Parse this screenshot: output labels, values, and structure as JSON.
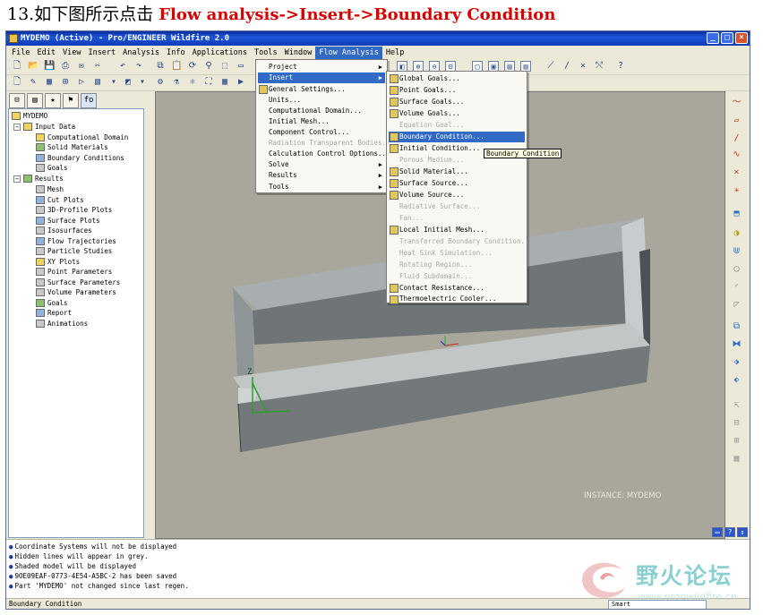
{
  "caption": {
    "prefix": "13.如下图所示点击 ",
    "highlight": "Flow analysis->Insert->Boundary Condition"
  },
  "window": {
    "title": "MYDEMO (Active) - Pro/ENGINEER Wildfire 2.0",
    "min": "_",
    "max": "□",
    "close": "×"
  },
  "menubar": [
    "File",
    "Edit",
    "View",
    "Insert",
    "Analysis",
    "Info",
    "Applications",
    "Tools",
    "Window",
    "Flow Analysis",
    "Help"
  ],
  "tree": {
    "root": "MYDEMO",
    "input_data": "Input Data",
    "input_children": [
      "Computational Domain",
      "Solid Materials",
      "Boundary Conditions",
      "Goals"
    ],
    "results": "Results",
    "results_children": [
      "Mesh",
      "Cut Plots",
      "3D-Profile Plots",
      "Surface Plots",
      "Isosurfaces",
      "Flow Trajectories",
      "Particle Studies",
      "XY Plots",
      "Point Parameters",
      "Surface Parameters",
      "Volume Parameters",
      "Goals",
      "Report",
      "Animations"
    ]
  },
  "flow_menu": [
    {
      "label": "Project",
      "sub": true,
      "disabled": false
    },
    {
      "label": "Insert",
      "sub": true,
      "disabled": false,
      "highlight": true
    },
    {
      "label": "General Settings...",
      "sub": false,
      "disabled": false
    },
    {
      "label": "Units...",
      "sub": false,
      "disabled": false
    },
    {
      "label": "Computational Domain...",
      "sub": false,
      "disabled": false
    },
    {
      "label": "Initial Mesh...",
      "sub": false,
      "disabled": false
    },
    {
      "label": "Component Control...",
      "sub": false,
      "disabled": false
    },
    {
      "label": "Radiation Transparent Bodies...",
      "sub": false,
      "disabled": true
    },
    {
      "label": "Calculation Control Options...",
      "sub": false,
      "disabled": false
    },
    {
      "label": "Solve",
      "sub": true,
      "disabled": false
    },
    {
      "label": "Results",
      "sub": true,
      "disabled": false
    },
    {
      "label": "Tools",
      "sub": true,
      "disabled": false
    }
  ],
  "insert_menu": [
    {
      "label": "Global Goals...",
      "disabled": false
    },
    {
      "label": "Point Goals...",
      "disabled": false
    },
    {
      "label": "Surface Goals...",
      "disabled": false
    },
    {
      "label": "Volume Goals...",
      "disabled": false
    },
    {
      "label": "Equation Goal...",
      "disabled": true
    },
    {
      "label": "Boundary Condition...",
      "disabled": false,
      "highlight": true
    },
    {
      "label": "Initial Condition...",
      "disabled": false
    },
    {
      "label": "Porous Medium...",
      "disabled": true
    },
    {
      "label": "Solid Material...",
      "disabled": false
    },
    {
      "label": "Surface Source...",
      "disabled": false
    },
    {
      "label": "Volume Source...",
      "disabled": false
    },
    {
      "label": "Radiative Surface...",
      "disabled": true
    },
    {
      "label": "Fan...",
      "disabled": true
    },
    {
      "label": "Local Initial Mesh...",
      "disabled": false
    },
    {
      "label": "Transferred Boundary Condition...",
      "disabled": true
    },
    {
      "label": "Heat Sink Simulation...",
      "disabled": true
    },
    {
      "label": "Rotating Region...",
      "disabled": true
    },
    {
      "label": "Fluid Subdomain...",
      "disabled": true
    },
    {
      "label": "Contact Resistance...",
      "disabled": false
    },
    {
      "label": "Thermoelectric Cooler...",
      "disabled": false
    }
  ],
  "tooltip": "Boundary Condition",
  "viewport": {
    "instance_label": "INSTANCE: MYDEMO",
    "axis_z": "Z"
  },
  "messages": [
    "Coordinate Systems will not be displayed",
    "Hidden lines will appear in grey.",
    "Shaded model will be displayed",
    "9OE09EAF-0773-4E54-A5BC-2 has been saved",
    "Part 'MYDEMO' not changed since last regen."
  ],
  "status": {
    "text": "Boundary Condition",
    "select": "Smart"
  },
  "watermark": {
    "text": "野火论坛",
    "url": "www.proewildfire.cn"
  },
  "colors": {
    "menu_highlight": "#316ac5",
    "caption_highlight": "#d40000",
    "viewport_bg": "#a9a79b"
  }
}
